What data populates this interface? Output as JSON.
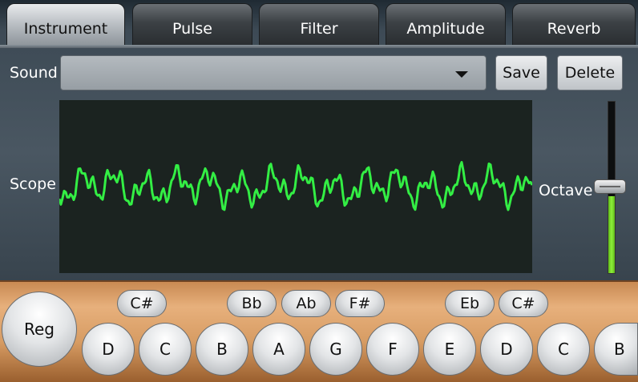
{
  "tabs": [
    {
      "label": "Instrument",
      "active": true
    },
    {
      "label": "Pulse",
      "active": false
    },
    {
      "label": "Filter",
      "active": false
    },
    {
      "label": "Amplitude",
      "active": false
    },
    {
      "label": "Reverb",
      "active": false
    }
  ],
  "sound": {
    "label": "Sound",
    "value": "",
    "save_label": "Save",
    "delete_label": "Delete"
  },
  "scope": {
    "label": "Scope",
    "waveform_color": "#33ee44"
  },
  "octave": {
    "label": "Octave",
    "level": 0.45,
    "fill_color": "#7ad62c"
  },
  "keyboard": {
    "reg_label": "Reg",
    "white_keys": [
      "D",
      "C",
      "B",
      "A",
      "G",
      "F",
      "E",
      "D",
      "C",
      "B"
    ],
    "black_keys": [
      "C#",
      "Bb",
      "Ab",
      "F#",
      "Eb",
      "C#"
    ]
  }
}
